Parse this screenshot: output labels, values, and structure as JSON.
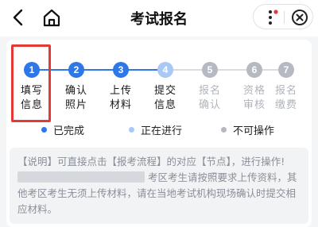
{
  "header": {
    "title": "考试报名",
    "back_icon": "back-arrow-icon",
    "home_icon": "home-icon",
    "more_icon": "more-dots-icon",
    "close_icon": "close-circle-icon"
  },
  "colors": {
    "done": "#2e77e6",
    "active": "#a9c9f4",
    "todo": "#b5b9c2",
    "highlight": "#e53935",
    "notification_dot": "#e53935"
  },
  "steps": [
    {
      "num": "1",
      "label": "填写信息",
      "status": "done"
    },
    {
      "num": "2",
      "label": "确认照片",
      "status": "done"
    },
    {
      "num": "3",
      "label": "上传材料",
      "status": "done"
    },
    {
      "num": "4",
      "label": "提交信息",
      "status": "active"
    },
    {
      "num": "5",
      "label": "报名确认",
      "status": "todo"
    },
    {
      "num": "6",
      "label": "资格审核",
      "status": "todo"
    },
    {
      "num": "7",
      "label": "报名缴费",
      "status": "todo"
    }
  ],
  "legend": {
    "done": "已完成",
    "active": "正在进行",
    "todo": "不可操作"
  },
  "notice": {
    "part1": "【说明】可直接点击【报考流程】的对应【节点】，进行操作!",
    "part2": "考区考生请按照要求上传资料，其他考区考生无须上传材料，请在当地考试机构现场确认时提交相应材料。"
  }
}
